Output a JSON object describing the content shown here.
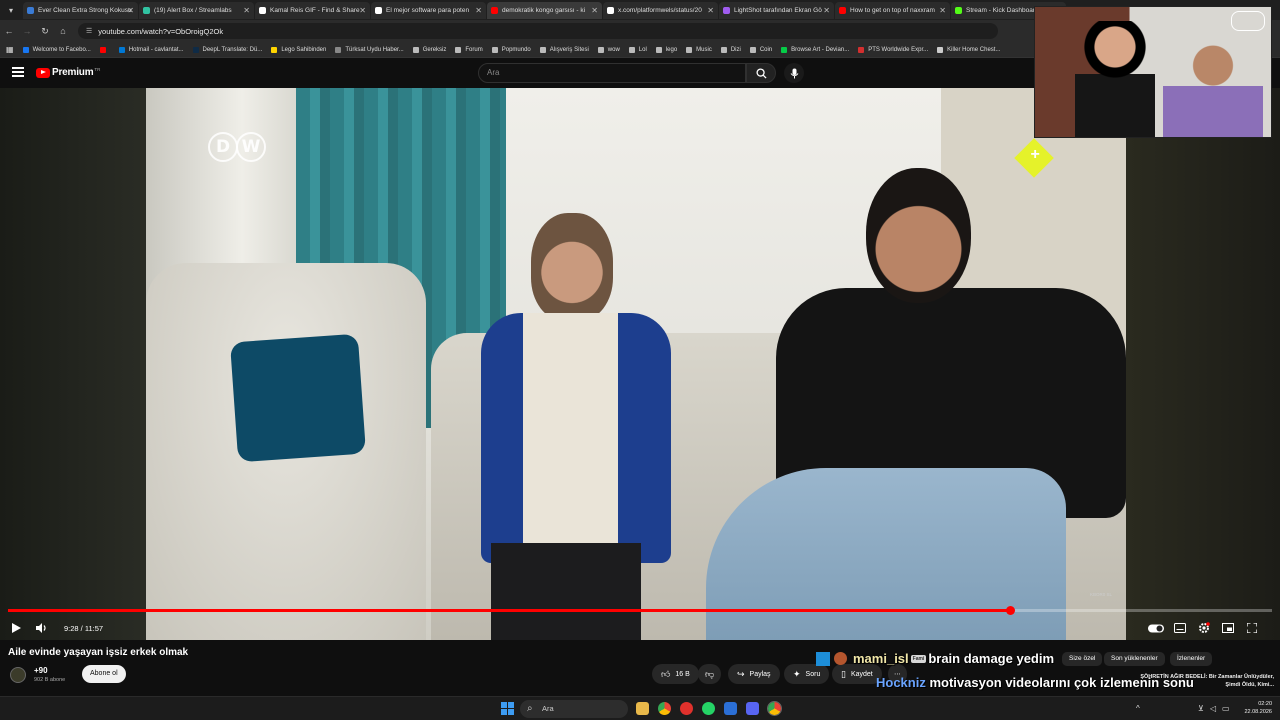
{
  "browser": {
    "tabs": [
      {
        "label": "Ever Clean Extra Strong Kokusu",
        "color": "#3a7bd5"
      },
      {
        "label": "(19) Alert Box / Streamlabs",
        "color": "#31c3a2"
      },
      {
        "label": "Kamal Reis GIF - Find & Share",
        "color": "#ffffff"
      },
      {
        "label": "El mejor software para poten",
        "color": "#ffffff"
      },
      {
        "label": "demokratik kongo garsısı - ki",
        "color": "#ff0000"
      },
      {
        "label": "x.com/platformwels/status/20",
        "color": "#ffffff"
      },
      {
        "label": "LightShot tarafından Ekran Gö",
        "color": "#a05cf0"
      },
      {
        "label": "How to get on top of naxxram",
        "color": "#ff0000"
      },
      {
        "label": "Stream - Kick Dashboard",
        "color": "#53fc18"
      }
    ],
    "url": "youtube.com/watch?v=ObOroigQ2Ok",
    "bookmarks": [
      {
        "label": "Welcome to Facebo...",
        "color": "#1877f2"
      },
      {
        "label": "",
        "color": "#ff0000"
      },
      {
        "label": "Hotmail - cavlantat...",
        "color": "#0078d4"
      },
      {
        "label": "DeepL Translate: Dü...",
        "color": "#0f2b46"
      },
      {
        "label": "Lego Sahibinden",
        "color": "#ffd500"
      },
      {
        "label": "Türksat Uydu Haber...",
        "color": "#888888"
      },
      {
        "label": "Gereksiz",
        "color": "#bbbbbb"
      },
      {
        "label": "Forum",
        "color": "#bbbbbb"
      },
      {
        "label": "Popmundo",
        "color": "#bbbbbb"
      },
      {
        "label": "Alışveriş Sitesi",
        "color": "#bbbbbb"
      },
      {
        "label": "wow",
        "color": "#bbbbbb"
      },
      {
        "label": "Lol",
        "color": "#bbbbbb"
      },
      {
        "label": "lego",
        "color": "#bbbbbb"
      },
      {
        "label": "Music",
        "color": "#bbbbbb"
      },
      {
        "label": "Dizi",
        "color": "#bbbbbb"
      },
      {
        "label": "Coin",
        "color": "#bbbbbb"
      },
      {
        "label": "Browse Art - Devian...",
        "color": "#05cc47"
      },
      {
        "label": "PTS Worldwide Expr...",
        "color": "#d32f2f"
      },
      {
        "label": "Killer Home Chest...",
        "color": "#cccccc"
      }
    ]
  },
  "youtube": {
    "logo_text": "Premium",
    "country_code": "TR",
    "search_placeholder": "Ara",
    "video": {
      "channel_logo": "DW",
      "watermark": "KBOR0 SL",
      "progress_fraction": 0.793,
      "time_text": "9:28 / 11:57",
      "title": "Aile evinde yaşayan işsiz erkek olmak"
    },
    "channel": {
      "name": "+90",
      "subscribers": "902 B abone",
      "subscribe_label": "Abone ol"
    },
    "actions": {
      "likes": "16 B",
      "share": "Paylaş",
      "ask": "Soru",
      "save": "Kaydet"
    },
    "chips": [
      "Size özel",
      "Son yüklenenler",
      "İzlenenler"
    ],
    "side_preview": "ŞÖHRETİN AĞIR BEDELİ: Bir Zamanlar Ünlüydüler, Şimdi Öldü, Kimi..."
  },
  "chat": [
    {
      "user": "mami_isl",
      "badge": "Fami",
      "message": "brain damage yedim"
    },
    {
      "user": "Hockniz",
      "message": "motivasyon videolarını çok izlemenin sonu"
    }
  ],
  "taskbar": {
    "search_label": "Ara",
    "time": "02:20",
    "date": "22.08.2026"
  }
}
